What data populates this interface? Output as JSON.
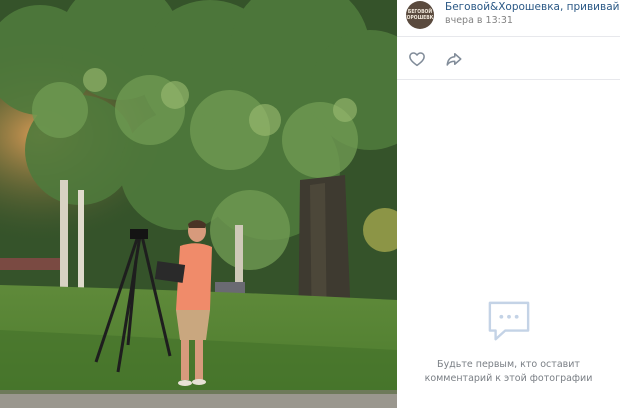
{
  "post": {
    "group_name": "Беговой&Хорошевка, прививайся!",
    "avatar_text": "БЕГОВОЙ\nХОРОШЕВКА",
    "date": "вчера в 13:31"
  },
  "actions": {
    "like_icon": "heart-icon",
    "share_icon": "share-arrow-icon"
  },
  "comments": {
    "empty_line1": "Будьте первым, кто оставит",
    "empty_line2": "комментарий к этой фотографии",
    "icon": "speech-bubble-icon"
  },
  "colors": {
    "link": "#2a5885",
    "muted": "#828282",
    "icon": "#818c99",
    "empty_icon": "#c4d3e6"
  }
}
